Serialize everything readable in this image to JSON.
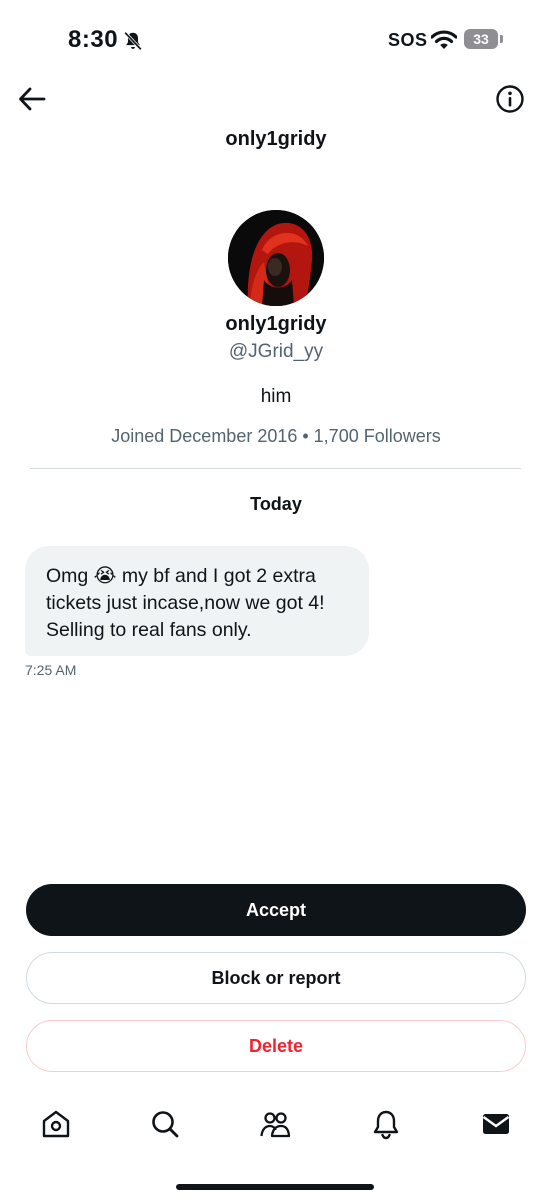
{
  "status_bar": {
    "time": "8:30",
    "carrier": "SOS",
    "battery": "33"
  },
  "header": {
    "title": "only1gridy"
  },
  "profile": {
    "display_name": "only1gridy",
    "handle": "@JGrid_yy",
    "bio": "him",
    "meta": "Joined December 2016 • 1,700 Followers"
  },
  "conversation": {
    "date_label": "Today",
    "messages": [
      {
        "text": "Omg 😭 my bf and I got 2 extra tickets just incase,now we got 4! Selling to real fans only.",
        "time": "7:25 AM"
      }
    ]
  },
  "actions": {
    "accept_label": "Accept",
    "block_label": "Block or report",
    "delete_label": "Delete"
  },
  "bottom_nav": {
    "items": [
      "home-icon",
      "search-icon",
      "communities-icon",
      "notifications-icon",
      "messages-icon"
    ],
    "active": "messages-icon"
  },
  "colors": {
    "accent_dark": "#0f1419",
    "secondary_text": "#536471",
    "danger": "#f4212e",
    "bubble_bg": "#eff3f4"
  }
}
